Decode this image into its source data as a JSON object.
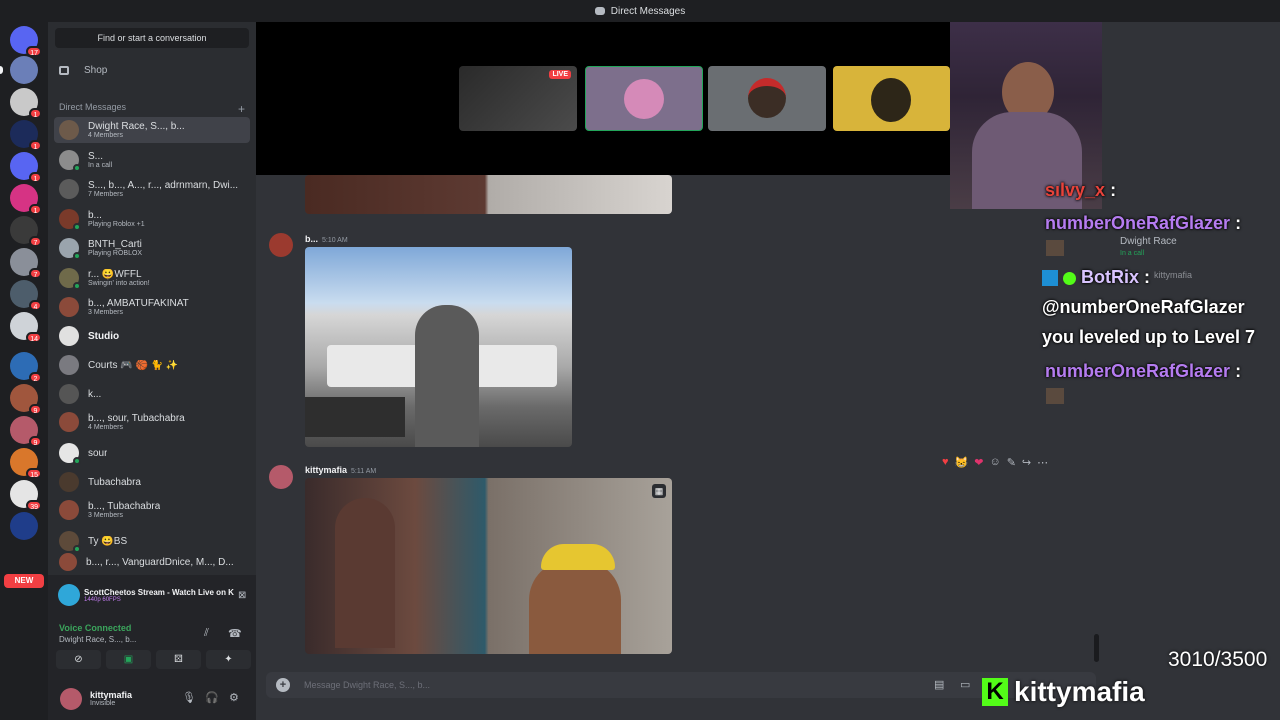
{
  "titlebar": {
    "title": "Direct Messages"
  },
  "servers": [
    {
      "badge": "17"
    },
    {
      "badge": ""
    },
    {
      "badge": "1"
    },
    {
      "badge": "1"
    },
    {
      "badge": "1"
    },
    {
      "badge": "1"
    },
    {
      "badge": "7"
    },
    {
      "badge": "7"
    },
    {
      "badge": "4"
    },
    {
      "badge": "14"
    },
    {
      "badge": "2"
    },
    {
      "badge": "9"
    },
    {
      "badge": "9"
    },
    {
      "badge": "15"
    },
    {
      "badge": "39"
    },
    {
      "badge": ""
    }
  ],
  "new_badge": "NEW",
  "dm_panel": {
    "find_label": "Find or start a conversation",
    "shop_label": "Shop",
    "header": "Direct Messages",
    "add": "+",
    "items": [
      {
        "name": "Dwight Race, S..., b...",
        "sub": "4 Members"
      },
      {
        "name": "S...",
        "sub": "In a call"
      },
      {
        "name": "S..., b..., A..., r..., adrnmarn, Dwi...",
        "sub": "7 Members"
      },
      {
        "name": "b...",
        "sub": "Playing Roblox +1"
      },
      {
        "name": "BNTH_Carti",
        "sub": "Playing ROBLOX"
      },
      {
        "name": "r... 😀WFFL",
        "sub": "Swingin' into action!"
      },
      {
        "name": "b..., AMBATUFAKINAT",
        "sub": "3 Members"
      },
      {
        "name": "Studio",
        "sub": ""
      },
      {
        "name": "Courts 🎮 🏀 🐈 ✨",
        "sub": ""
      },
      {
        "name": "k...",
        "sub": ""
      },
      {
        "name": "b..., sour, Tubachabra",
        "sub": "4 Members"
      },
      {
        "name": "sour",
        "sub": ""
      },
      {
        "name": "Tubachabra",
        "sub": ""
      },
      {
        "name": "b..., Tubachabra",
        "sub": "3 Members"
      },
      {
        "name": "Ty 😀BS",
        "sub": ""
      },
      {
        "name": "b..., r..., VanguardDnice, M..., D...",
        "sub": ""
      }
    ]
  },
  "stream_panel": {
    "title": "ScottCheetos Stream - Watch Live on Kick a...",
    "quality": "1440p 60FPS"
  },
  "voice": {
    "status": "Voice Connected",
    "channel": "Dwight Race, S..., b..."
  },
  "user": {
    "name": "kittymafia",
    "status": "Invisible"
  },
  "call": {
    "live_label": "LIVE"
  },
  "messages": [
    {
      "author": "b...",
      "time": "5:10 AM"
    },
    {
      "author": "kittymafia",
      "time": "5:11 AM"
    }
  ],
  "composer": {
    "placeholder": "Message Dwight Race, S..., b..."
  },
  "overlay": {
    "chat": [
      {
        "user": "sılvy_x",
        "text": ":",
        "color": "#e8433b"
      },
      {
        "user": "numberOneRafGlazer",
        "text": ":",
        "color": "#b57cf0"
      },
      {
        "user": "BotRix",
        "text": ":",
        "color": "#d9c4ff"
      },
      {
        "user": "",
        "text": "@numberOneRafGlazer",
        "color": "#ffffff"
      },
      {
        "user": "",
        "text": "you leveled up to Level 7",
        "color": "#ffffff"
      },
      {
        "user": "numberOneRafGlazer",
        "text": ":",
        "color": "#b57cf0"
      }
    ],
    "dwight_name": "Dwight Race",
    "dwight_status": "In a call",
    "kitty_ghost": "kittymafia",
    "counter": "3010/3500",
    "brand": "kittymafia",
    "brand_icon": "K"
  },
  "colors": {
    "accent": "#5865f2",
    "online": "#23a55a",
    "danger": "#f23f43",
    "kick": "#53fc18"
  }
}
